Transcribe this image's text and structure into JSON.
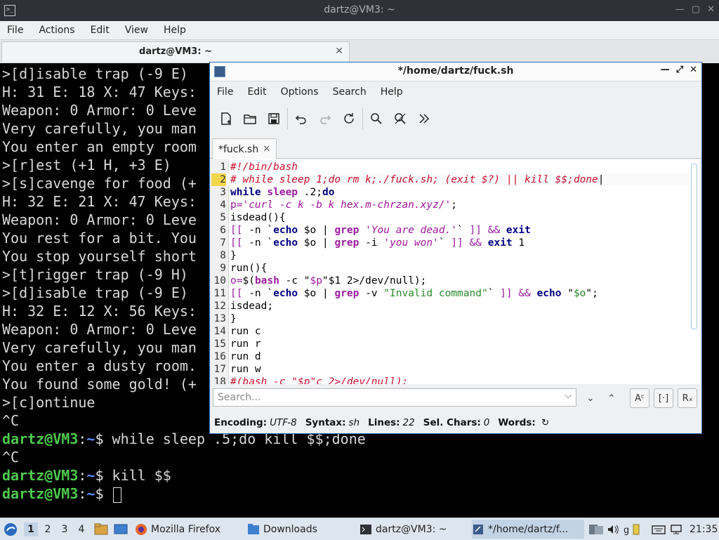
{
  "terminal": {
    "title": "dartz@VM3: ~",
    "menu": [
      "File",
      "Actions",
      "Edit",
      "View",
      "Help"
    ],
    "tab": "dartz@VM3: ~",
    "lines": [
      ">[d]isable trap (-9 E)",
      "H: 31 E: 18 X: 47 Keys:",
      "Weapon: 0 Armor: 0 Leve",
      "Very carefully, you man",
      "You enter an empty room",
      ">[r]est (+1 H, +3 E)",
      ">[s]cavenge for food (+",
      "H: 32 E: 21 X: 47 Keys:",
      "Weapon: 0 Armor: 0 Leve",
      "You rest for a bit. You",
      "You stop yourself short",
      ">[t]rigger trap (-9 H)",
      ">[d]isable trap (-9 E)",
      "H: 32 E: 12 X: 56 Keys:",
      "Weapon: 0 Armor: 0 Leve",
      "Very carefully, you man",
      "You enter a dusty room.",
      "You found some gold! (+",
      ">[c]ontinue",
      "^C"
    ],
    "prompt_user": "dartz@VM3",
    "prompt_sep": ":",
    "prompt_path": "~",
    "prompt_sym": "$",
    "cmd1": " while sleep .5;do kill $$;done",
    "ctrl_c": "^C",
    "cmd2": " kill $$",
    "cmd3": " "
  },
  "editor": {
    "title": "*/home/dartz/fuck.sh",
    "menu": [
      "File",
      "Edit",
      "Options",
      "Search",
      "Help"
    ],
    "tab": "*fuck.sh",
    "line_numbers": [
      "1",
      "2",
      "3",
      "4",
      "5",
      "6",
      "7",
      "8",
      "9",
      "10",
      "11",
      "12",
      "13",
      "14",
      "15",
      "16",
      "17",
      "18"
    ],
    "search_placeholder": "Search...",
    "status": {
      "encoding_label": "Encoding:",
      "encoding": "UTF-8",
      "syntax_label": "Syntax:",
      "syntax": "sh",
      "lines_label": "Lines:",
      "lines": "22",
      "selchars_label": "Sel. Chars:",
      "selchars": "0",
      "words_label": "Words:"
    }
  },
  "taskbar": {
    "workspaces": [
      "1",
      "2",
      "3",
      "4"
    ],
    "tasks": [
      "Mozilla Firefox",
      "Downloads",
      "dartz@VM3: ~",
      "*/home/dartz/f..."
    ],
    "clock": "21:35"
  },
  "colors": {
    "terminal_bg": "#000000",
    "prompt_user": "#4ec94e",
    "prompt_path": "#5f8fff",
    "comment": "#c8102e",
    "keyword": "#000080",
    "command": "#9a1ca0",
    "string": "#2a8a2a",
    "current_line_marker": "#f3d64c"
  }
}
